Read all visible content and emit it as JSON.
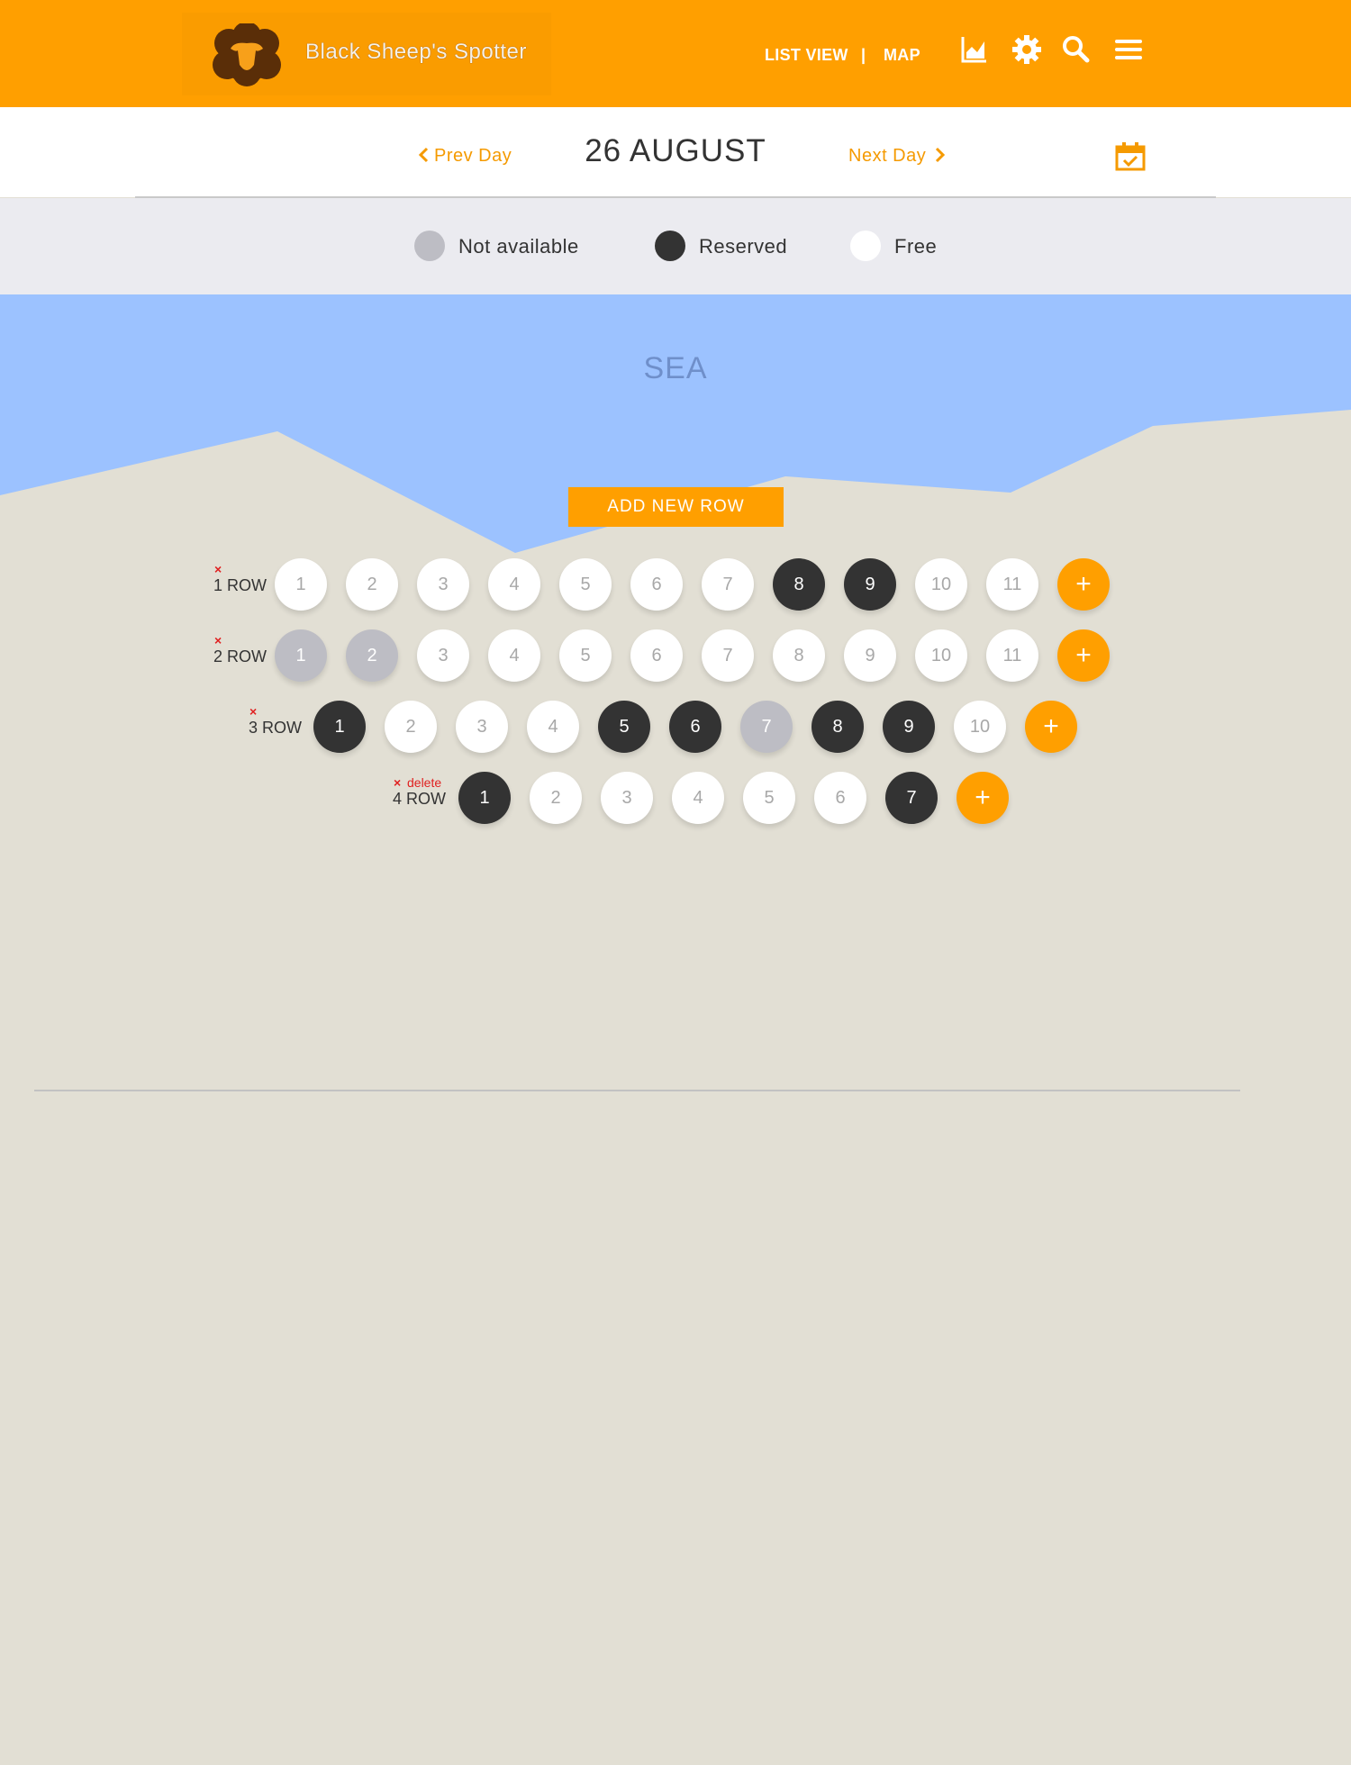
{
  "header": {
    "app_name": "Black Sheep's Spotter",
    "nav": {
      "list_view": "LIST VIEW",
      "separator": "|",
      "map": "MAP"
    },
    "icons": [
      "chart-icon",
      "gear-icon",
      "search-icon",
      "menu-icon"
    ]
  },
  "datebar": {
    "prev_label": "Prev Day",
    "next_label": "Next Day",
    "date": "26 AUGUST",
    "calendar_icon": "calendar-check-icon"
  },
  "legend": [
    {
      "label": "Not available",
      "color": "#bdbdc4"
    },
    {
      "label": "Reserved",
      "color": "#333333"
    },
    {
      "label": "Free",
      "color": "#ffffff"
    }
  ],
  "sea_label": "SEA",
  "add_row_label": "ADD NEW ROW",
  "add_seat_label": "+",
  "rows": [
    {
      "label": "1 ROW",
      "delete_label": "",
      "seats": [
        {
          "n": "1",
          "s": "free"
        },
        {
          "n": "2",
          "s": "free"
        },
        {
          "n": "3",
          "s": "free"
        },
        {
          "n": "4",
          "s": "free"
        },
        {
          "n": "5",
          "s": "free"
        },
        {
          "n": "6",
          "s": "free"
        },
        {
          "n": "7",
          "s": "free"
        },
        {
          "n": "8",
          "s": "reserved"
        },
        {
          "n": "9",
          "s": "reserved"
        },
        {
          "n": "10",
          "s": "free"
        },
        {
          "n": "11",
          "s": "free"
        }
      ]
    },
    {
      "label": "2 ROW",
      "delete_label": "",
      "seats": [
        {
          "n": "1",
          "s": "unavailable"
        },
        {
          "n": "2",
          "s": "unavailable"
        },
        {
          "n": "3",
          "s": "free"
        },
        {
          "n": "4",
          "s": "free"
        },
        {
          "n": "5",
          "s": "free"
        },
        {
          "n": "6",
          "s": "free"
        },
        {
          "n": "7",
          "s": "free"
        },
        {
          "n": "8",
          "s": "free"
        },
        {
          "n": "9",
          "s": "free"
        },
        {
          "n": "10",
          "s": "free"
        },
        {
          "n": "11",
          "s": "free"
        }
      ]
    },
    {
      "label": "3 ROW",
      "delete_label": "",
      "seats": [
        {
          "n": "1",
          "s": "reserved"
        },
        {
          "n": "2",
          "s": "free"
        },
        {
          "n": "3",
          "s": "free"
        },
        {
          "n": "4",
          "s": "free"
        },
        {
          "n": "5",
          "s": "reserved"
        },
        {
          "n": "6",
          "s": "reserved"
        },
        {
          "n": "7",
          "s": "unavailable"
        },
        {
          "n": "8",
          "s": "reserved"
        },
        {
          "n": "9",
          "s": "reserved"
        },
        {
          "n": "10",
          "s": "free"
        }
      ]
    },
    {
      "label": "4 ROW",
      "delete_label": "delete",
      "seats": [
        {
          "n": "1",
          "s": "reserved"
        },
        {
          "n": "2",
          "s": "free"
        },
        {
          "n": "3",
          "s": "free"
        },
        {
          "n": "4",
          "s": "free"
        },
        {
          "n": "5",
          "s": "free"
        },
        {
          "n": "6",
          "s": "free"
        },
        {
          "n": "7",
          "s": "reserved"
        }
      ]
    }
  ],
  "colors": {
    "accent": "#ff9f00",
    "sea": "#9cc2ff",
    "sand": "#e2dfd4"
  }
}
